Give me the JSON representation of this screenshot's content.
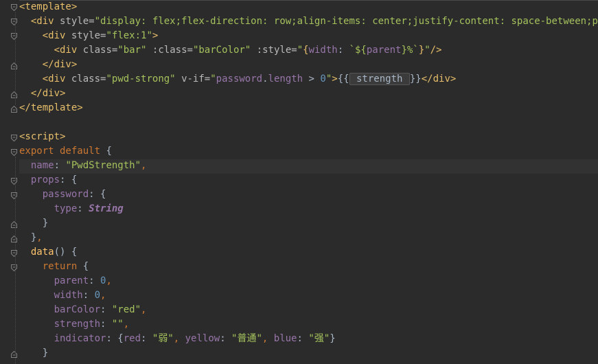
{
  "editor": {
    "language": "vue",
    "theme": "darcula",
    "lines": [
      "<template>",
      "  <div style=\"display: flex;flex-direction: row;align-items: center;justify-content: space-between;padding",
      "    <div style=\"flex:1\">",
      "      <div class=\"bar\" :class=\"barColor\" :style=\"{width: `${parent}%`}\"/>",
      "    </div>",
      "    <div class=\"pwd-strong\" v-if=\"password.length > 0\">{{ strength }}</div>",
      "  </div>",
      "</template>",
      "",
      "<script>",
      "export default {",
      "  name: \"PwdStrength\",",
      "  props: {",
      "    password: {",
      "      type: String",
      "    }",
      "  },",
      "  data() {",
      "    return {",
      "      parent: 0,",
      "      width: 0,",
      "      barColor: \"red\",",
      "      strength: \"\",",
      "      indicator: {red: \"弱\", yellow: \"普通\", blue: \"强\"}",
      "    }"
    ]
  },
  "tokens": {
    "l1": {
      "open": "<template>"
    },
    "l2": {
      "tag": "<div",
      "attr": "style",
      "eq": "=",
      "value": "\"display: flex;flex-direction: row;align-items: center;justify-content: space-between;padding"
    },
    "l3": {
      "tag": "<div",
      "attr": "style",
      "eq": "=",
      "value": "\"flex:1\"",
      "close": ">"
    },
    "l4": {
      "tag": "<div",
      "attr1": "class",
      "eq1": "=",
      "val1": "\"bar\"",
      "attr2": ":class",
      "eq2": "=",
      "val2": "\"barColor\"",
      "attr3": ":style",
      "eq3": "=",
      "q": "\"",
      "b1": "{",
      "k": "width",
      "c": ": ",
      "bt": "`${",
      "p": "parent",
      "rest": "}%`",
      "b2": "}",
      "q2": "\"",
      "close": "/>"
    },
    "l5": {
      "close": "</div>"
    },
    "l6": {
      "tag": "<div",
      "attr1": "class",
      "eq1": "=",
      "val1": "\"pwd-strong\"",
      "attr2": "v-if",
      "eq2": "=",
      "q": "\"",
      "expr1": "password",
      "dot": ".",
      "expr2": "length",
      "op": " > ",
      "num": "0",
      "q2": "\"",
      "gt": ">",
      "mopen": "{{",
      "mval": " strength ",
      "mclose": "}}",
      "close": "</div>"
    },
    "l7": {
      "close": "</div>"
    },
    "l8": {
      "close": "</template>"
    },
    "l10": {
      "open": "<script>"
    },
    "l11": {
      "kw": "export default ",
      "brace": "{"
    },
    "l12": {
      "key": "name",
      "colon": ": ",
      "val": "\"PwdStrength\"",
      "comma": ","
    },
    "l13": {
      "key": "props",
      "colon": ": ",
      "brace": "{"
    },
    "l14": {
      "key": "password",
      "colon": ": ",
      "brace": "{"
    },
    "l15": {
      "key": "type",
      "colon": ": ",
      "val": "String"
    },
    "l16": {
      "brace": "}"
    },
    "l17": {
      "brace": "}",
      "comma": ","
    },
    "l18": {
      "fn": "data",
      "paren": "() ",
      "brace": "{"
    },
    "l19": {
      "kw": "return ",
      "brace": "{"
    },
    "l20": {
      "key": "parent",
      "colon": ": ",
      "num": "0",
      "comma": ","
    },
    "l21": {
      "key": "width",
      "colon": ": ",
      "num": "0",
      "comma": ","
    },
    "l22": {
      "key": "barColor",
      "colon": ": ",
      "val": "\"red\"",
      "comma": ","
    },
    "l23": {
      "key": "strength",
      "colon": ": ",
      "val": "\"\"",
      "comma": ","
    },
    "l24": {
      "key": "indicator",
      "colon": ": ",
      "b1": "{",
      "k1": "red",
      "c1": ": ",
      "v1": "\"弱\"",
      "s1": ", ",
      "k2": "yellow",
      "c2": ": ",
      "v2": "\"普通\"",
      "s2": ", ",
      "k3": "blue",
      "c3": ": ",
      "v3": "\"强\"",
      "b2": "}"
    },
    "l25": {
      "brace": "}"
    }
  },
  "colors": {
    "background": "#2b2b2b",
    "tag": "#e8bf6a",
    "string": "#a5c25c",
    "keyword": "#cc7832",
    "property": "#9876aa",
    "number": "#6897bb",
    "function": "#ffc66d",
    "text": "#a9b7c6"
  }
}
